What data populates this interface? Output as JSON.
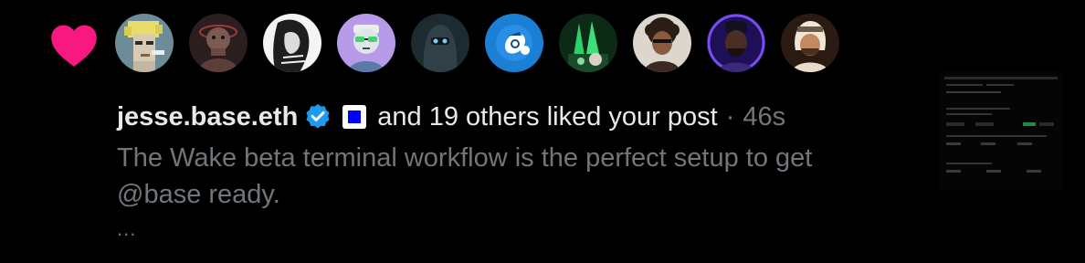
{
  "notification": {
    "type_icon": "heart-icon",
    "username": "jesse.base.eth",
    "verified_icon": "verified-badge-icon",
    "extra_badge_icon": "blue-square-icon",
    "action_text": "and 19 others liked your post",
    "separator": "·",
    "time": "46s",
    "post_preview": "The Wake beta terminal workflow is the perfect setup to get @base ready.",
    "ellipsis": "..."
  },
  "colors": {
    "background": "#000000",
    "heart": "#f91880",
    "verified": "#1d9bf0",
    "primary_text": "#e7e9ea",
    "secondary_text": "#71767b",
    "square_badge": "#0000ff"
  }
}
